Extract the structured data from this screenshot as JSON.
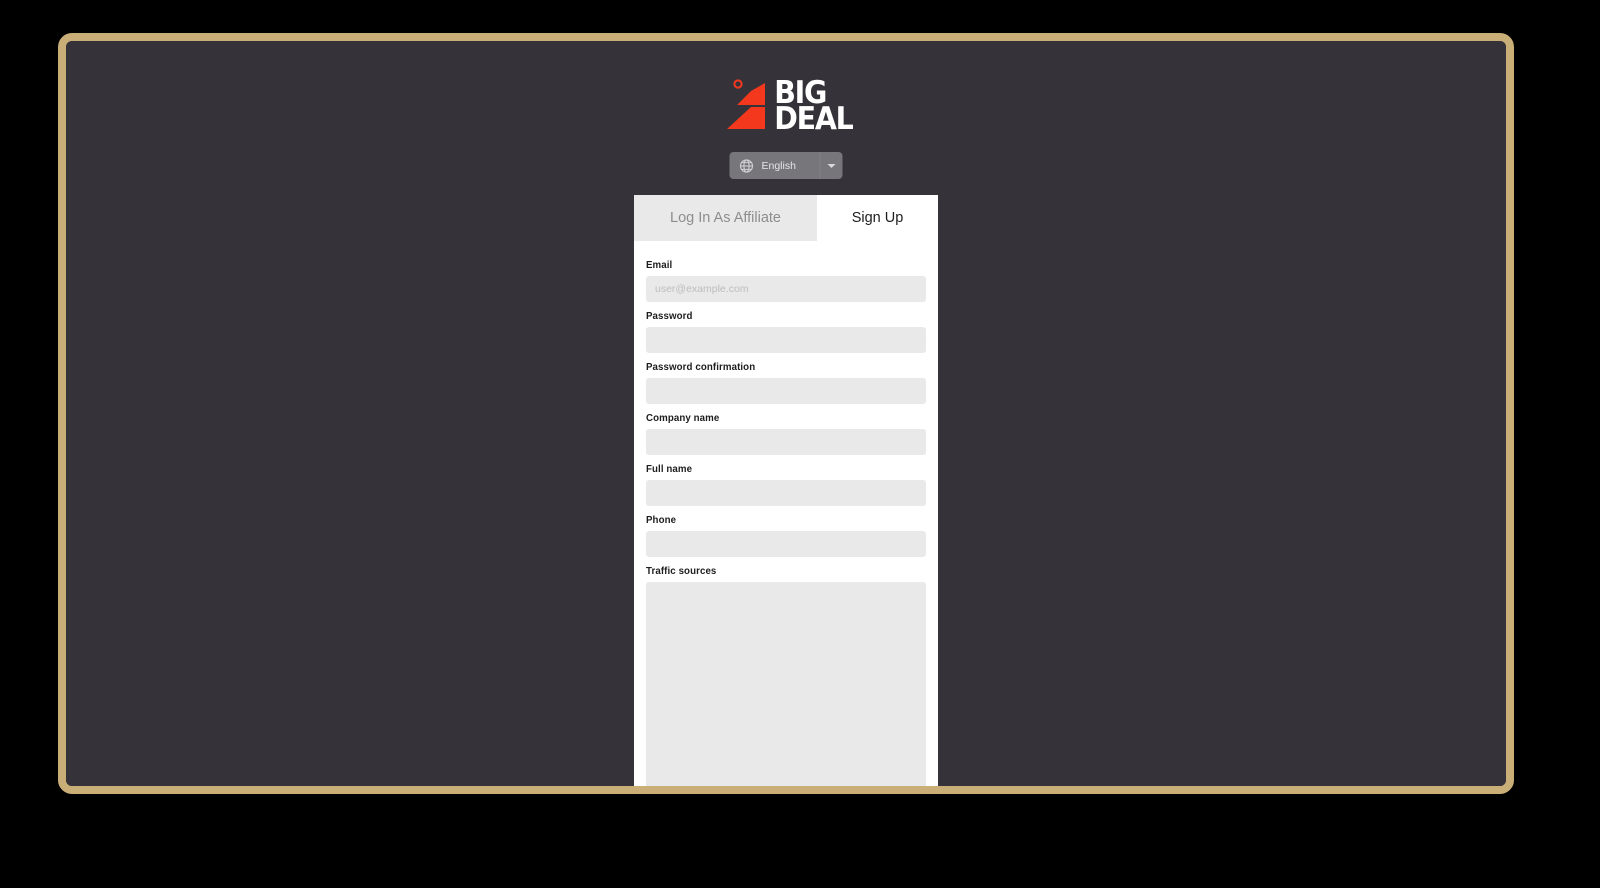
{
  "window": {
    "frame_color": "#c9ae78",
    "page_background": "#353339"
  },
  "brand": {
    "logo_mark_name": "bigdeal-lightning-mark",
    "logo_mark_color": "#f4381e",
    "word_top": "BIG",
    "word_bottom": "DEAL"
  },
  "language_selector": {
    "icon": "globe-icon",
    "value": "English",
    "caret_icon": "chevron-down-icon"
  },
  "tabs": [
    {
      "id": "login",
      "label": "Log In As Affiliate",
      "active": false
    },
    {
      "id": "signup",
      "label": "Sign Up",
      "active": true
    }
  ],
  "form": {
    "fields": [
      {
        "name": "email",
        "label": "Email",
        "type": "email",
        "value": "",
        "placeholder": "user@example.com"
      },
      {
        "name": "password",
        "label": "Password",
        "type": "password",
        "value": "",
        "placeholder": ""
      },
      {
        "name": "password-confirmation",
        "label": "Password confirmation",
        "type": "password",
        "value": "",
        "placeholder": ""
      },
      {
        "name": "company-name",
        "label": "Company name",
        "type": "text",
        "value": "",
        "placeholder": ""
      },
      {
        "name": "full-name",
        "label": "Full name",
        "type": "text",
        "value": "",
        "placeholder": ""
      },
      {
        "name": "phone",
        "label": "Phone",
        "type": "text",
        "value": "",
        "placeholder": ""
      },
      {
        "name": "traffic-sources",
        "label": "Traffic sources",
        "type": "textarea",
        "value": "",
        "placeholder": ""
      }
    ]
  }
}
